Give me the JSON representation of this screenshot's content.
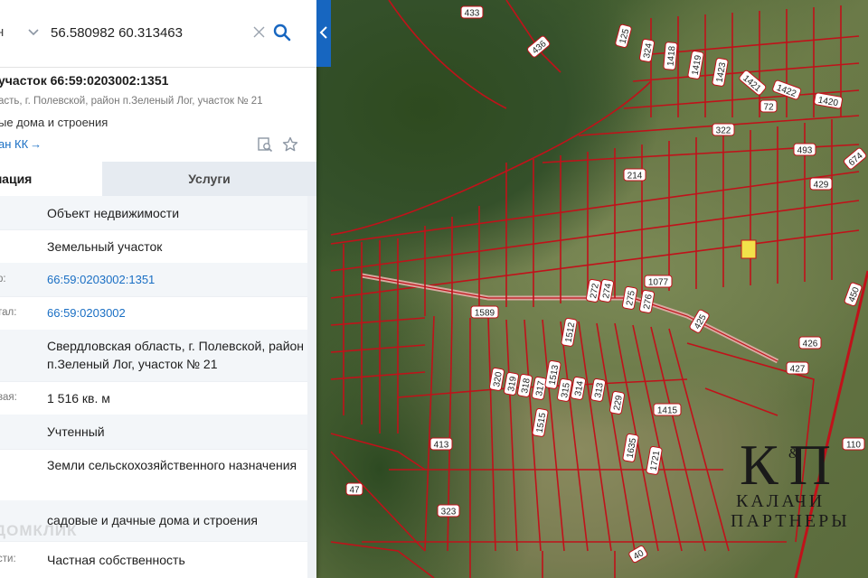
{
  "search": {
    "prefix_text": "н",
    "query": "56.580982 60.313463"
  },
  "object": {
    "title": "участок 66:59:0203002:1351",
    "address": "асть, г. Полевской, район п.Зеленый Лог, участок № 21",
    "use": "ые дома и строения",
    "plan_link": "ан КК"
  },
  "tabs": {
    "info": "мация",
    "services": "Услуги"
  },
  "rows": [
    {
      "label": "",
      "value": "Объект недвижимости"
    },
    {
      "label": "",
      "value": "Земельный участок"
    },
    {
      "label": "р:",
      "value": "66:59:0203002:1351"
    },
    {
      "label": "тал:",
      "value": "66:59:0203002"
    },
    {
      "label": "",
      "value": "Свердловская область, г. Полевской, район п.Зеленый Лог, участок № 21"
    },
    {
      "label": "вая:",
      "value": "1 516 кв. м"
    },
    {
      "label": "",
      "value": "Учтенный"
    },
    {
      "label": "",
      "value": "Земли сельскохозяйственного назначения"
    },
    {
      "label": "",
      "value": "садовые и дачные дома и строения"
    },
    {
      "label": "сти:",
      "value": "Частная собственность"
    }
  ],
  "watermark": "ДОМКЛИК",
  "logo": {
    "letters": "К П",
    "amp": "&",
    "line1": "КАЛАЧИ",
    "line2": "ПАРТНЕРЫ"
  },
  "map_labels": [
    "433",
    "436",
    "125",
    "324",
    "1418",
    "1419",
    "1423",
    "1421",
    "1422",
    "1420",
    "72",
    "322",
    "493",
    "674",
    "214",
    "429",
    "1077",
    "272",
    "274",
    "275",
    "276",
    "1589",
    "1512",
    "425",
    "426",
    "427",
    "450",
    "320",
    "319",
    "318",
    "317",
    "1513",
    "315",
    "314",
    "313",
    "229",
    "1415",
    "1515",
    "1635",
    "1721",
    "413",
    "47",
    "323",
    "110",
    "40"
  ],
  "colors": {
    "accent": "#1766c0",
    "boundary": "#c0121a",
    "highlight": "#f2e14a"
  }
}
